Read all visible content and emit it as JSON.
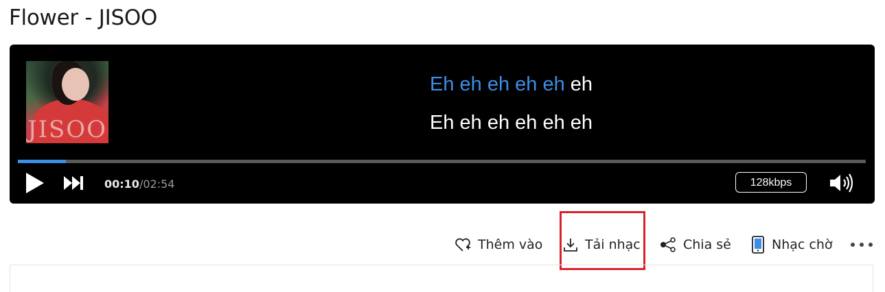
{
  "song_title": "Flower - JISOO",
  "cover": {
    "text": "JISOO"
  },
  "lyrics": {
    "line1_sung": "Eh eh eh eh eh",
    "line1_rest": " eh",
    "line2": "Eh eh eh eh eh eh"
  },
  "player": {
    "progress": 0.057,
    "current_time": "00:10",
    "separator": "/",
    "total_time": "02:54",
    "bitrate": "128kbps",
    "accent_color": "#3c8ee8"
  },
  "actions": {
    "add_label": "Thêm vào",
    "download_label": "Tải nhạc",
    "share_label": "Chia sẻ",
    "ringtone_label": "Nhạc chờ"
  },
  "icons": {
    "play": "play-icon",
    "next": "next-icon",
    "volume": "volume-icon",
    "add": "heart-plus-icon",
    "download": "download-icon",
    "share": "share-icon",
    "ringtone": "phone-icon",
    "more": "more-icon"
  }
}
